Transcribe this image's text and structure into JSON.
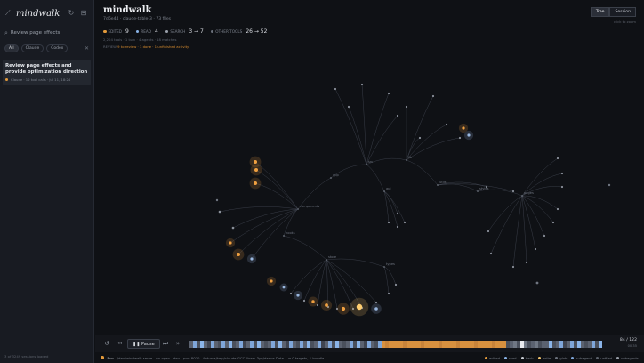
{
  "app": {
    "name": "mindwalk"
  },
  "sidebar": {
    "search_placeholder": "Review page effects",
    "filters": [
      {
        "label": "All",
        "active": true
      },
      {
        "label": "Claude",
        "active": false
      },
      {
        "label": "Codex",
        "active": false
      }
    ],
    "session": {
      "title": "Review page effects and provide optimization direction",
      "meta": "Claude · 12 tool calls · Jul 11, 18:24"
    },
    "footer": "3 of 3249 sessions loaded"
  },
  "header": {
    "title": "mindwalk",
    "subtitle": "7d6e44 · claude-table-3 · 73 files",
    "stats": [
      {
        "label": "EDITED",
        "value": "9",
        "color": "#e39a3b"
      },
      {
        "label": "READ",
        "value": "4",
        "color": "#8ab4e8"
      },
      {
        "label": "SEARCH",
        "value": "3 → 7",
        "color": "#9aa0aa"
      },
      {
        "label": "OTHER TOOLS",
        "value": "26 → 52",
        "color": "#6b717c"
      }
    ],
    "meta_line": "2,204 tools · 1 turn · 4 agents · 18 matches",
    "review_label": "REVIEW",
    "review_items": "9 to review · 3 done · 1 unfinished activity",
    "buttons": [
      {
        "label": "Tree",
        "active": true
      },
      {
        "label": "Session",
        "active": false
      }
    ],
    "top_note": "click to zoom"
  },
  "graph": {
    "labels": [
      "src",
      "app",
      "components",
      "lib",
      "utils",
      "styles",
      "pages",
      "api",
      "hooks",
      "store",
      "types",
      "public",
      "config",
      "tests",
      "docs",
      "assets"
    ]
  },
  "playback": {
    "pause_label": "Pause",
    "counter": "84 / 122",
    "counter_sub": "00:35"
  },
  "status": {
    "label": "Run",
    "text": "/dev/mindwalk serve --no-open --dev --port 8070 --fixtures/tmp/claude-GCC-Users-3yn/dance-Data... → 0 targets, 1 bundle",
    "legend": [
      {
        "label": "edited",
        "color": "#e39a3b"
      },
      {
        "label": "read",
        "color": "#8ab4e8"
      },
      {
        "label": "bash",
        "color": "#c9cdd4"
      },
      {
        "label": "write",
        "color": "#f2c46d"
      },
      {
        "label": "glob",
        "color": "#6b717c"
      },
      {
        "label": "subagent",
        "color": "#7fa6d9"
      },
      {
        "label": "unfiled",
        "color": "#5d626c"
      },
      {
        "label": "subagents",
        "color": "#9aa0aa"
      }
    ]
  },
  "colors": {
    "accent": "#e39a3b",
    "read": "#8ab4e8",
    "bg": "#0f1115"
  }
}
